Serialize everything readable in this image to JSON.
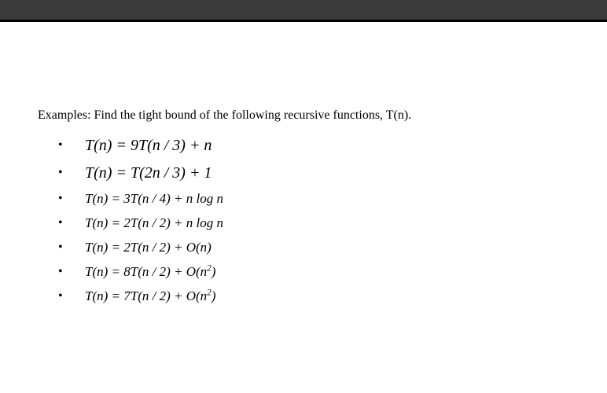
{
  "intro": "Examples: Find the tight bound of the following recursive functions, T(n). ",
  "equations": [
    {
      "html": "T(n) = 9T(n / 3) + n",
      "size": "large"
    },
    {
      "html": "T(n) = T(2n / 3) + 1",
      "size": "large"
    },
    {
      "html": "T(n) = 3T(n / 4) + n log n",
      "size": "small"
    },
    {
      "html": "T(n) = 2T(n / 2) + n log n",
      "size": "small"
    },
    {
      "html": "T(n) = 2T(n / 2) + O(n)",
      "size": "small"
    },
    {
      "html": "T(n) = 8T(n / 2) + O(n<sup>2</sup>)",
      "size": "small"
    },
    {
      "html": "T(n) = 7T(n / 2) + O(n<sup>2</sup>)",
      "size": "small"
    }
  ]
}
